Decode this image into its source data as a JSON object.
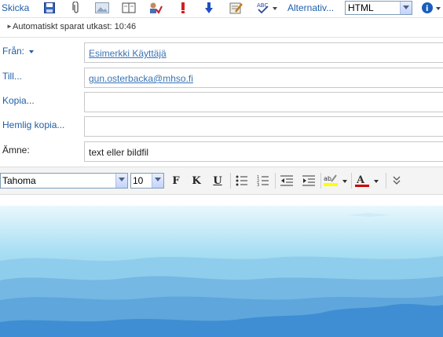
{
  "toolbar": {
    "send_label": "Skicka",
    "options_label": "Alternativ...",
    "format_select": "HTML",
    "icons": [
      "save-icon",
      "attachment-icon",
      "insert-picture-icon",
      "address-book-icon",
      "check-names-icon",
      "high-importance-icon",
      "low-importance-icon",
      "signature-icon",
      "spellcheck-icon",
      "help-icon"
    ]
  },
  "autosave": {
    "text": "Automatiskt sparat utkast: 10:46"
  },
  "header": {
    "from_label": "Från:",
    "from_value": "Esimerkki Käyttäjä",
    "to_label": "Till...",
    "to_value": "gun.osterbacka@mhso.fi",
    "cc_label": "Kopia...",
    "cc_value": "",
    "bcc_label": "Hemlig kopia...",
    "bcc_value": "",
    "subject_label": "Ämne:",
    "subject_value": "text eller bildfil"
  },
  "format": {
    "font": "Tahoma",
    "size": "10",
    "bold": "F",
    "italic": "K",
    "underline": "U",
    "colors": {
      "highlight": "#ffff00",
      "font": "#cc0000"
    }
  },
  "colors": {
    "accent": "#1f5fa8",
    "link": "#3a74b5"
  }
}
